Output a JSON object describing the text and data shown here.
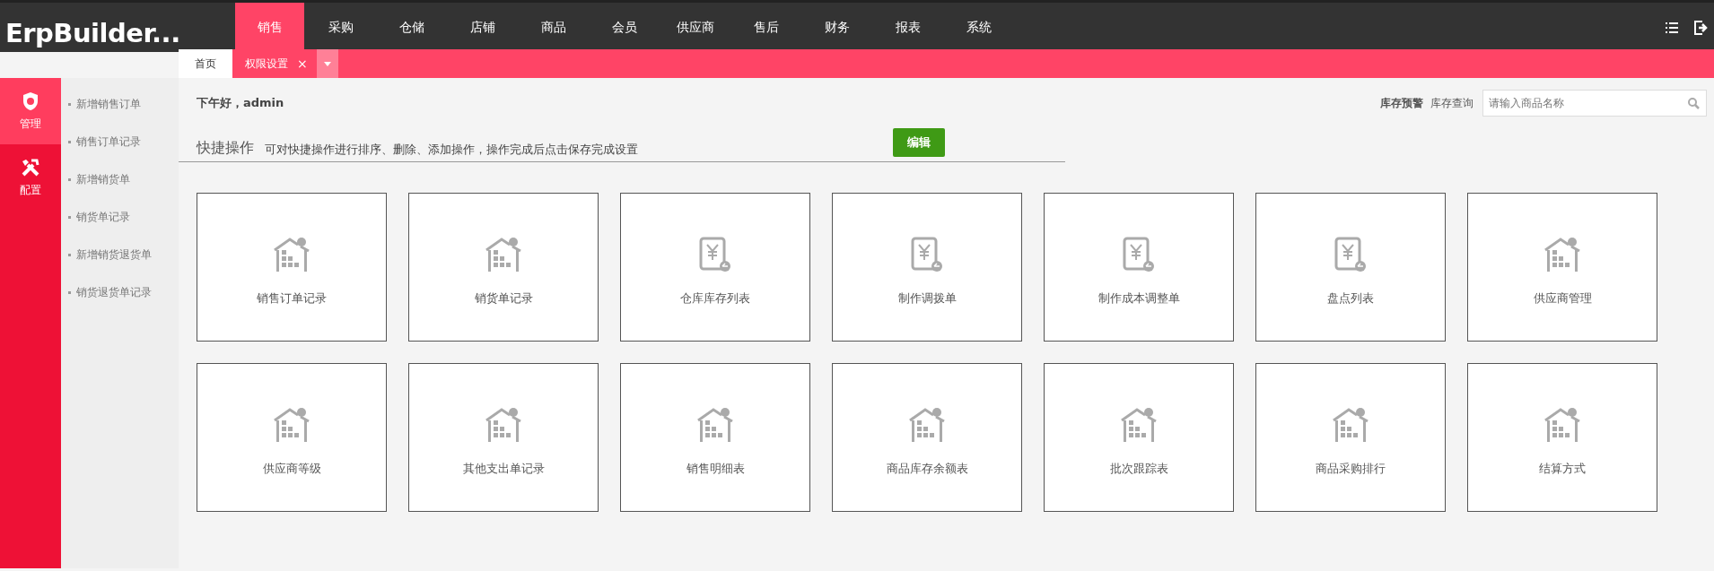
{
  "logo": "ErpBuilder...",
  "nav": [
    {
      "label": "销售",
      "selected": true
    },
    {
      "label": "采购",
      "selected": false
    },
    {
      "label": "仓储",
      "selected": false
    },
    {
      "label": "店铺",
      "selected": false
    },
    {
      "label": "商品",
      "selected": false
    },
    {
      "label": "会员",
      "selected": false
    },
    {
      "label": "供应商",
      "selected": false
    },
    {
      "label": "售后",
      "selected": false
    },
    {
      "label": "财务",
      "selected": false
    },
    {
      "label": "报表",
      "selected": false
    },
    {
      "label": "系统",
      "selected": false
    }
  ],
  "tabs": [
    {
      "label": "首页",
      "selected": false,
      "closable": false
    },
    {
      "label": "权限设置",
      "selected": true,
      "closable": true,
      "close": "×"
    }
  ],
  "modules": [
    {
      "label": "管理",
      "kind": "shield",
      "selected": true
    },
    {
      "label": "配置",
      "kind": "tools",
      "selected": false
    }
  ],
  "submenu": [
    "新增销售订单",
    "销售订单记录",
    "新增销货单",
    "销货单记录",
    "新增销货退货单",
    "销货退货单记录"
  ],
  "greeting": "下午好，admin",
  "links": [
    "库存预警",
    "库存查询"
  ],
  "search": {
    "placeholder": "请输入商品名称"
  },
  "quick": {
    "title": "快捷操作",
    "hint": "可对快捷操作进行排序、删除、添加操作，操作完成后点击保存完成设置",
    "button": "编辑"
  },
  "tiles": [
    {
      "label": "销售订单记录",
      "kind": "house"
    },
    {
      "label": "销货单记录",
      "kind": "house"
    },
    {
      "label": "仓库库存列表",
      "kind": "yen"
    },
    {
      "label": "制作调拨单",
      "kind": "yen"
    },
    {
      "label": "制作成本调整单",
      "kind": "yen"
    },
    {
      "label": "盘点列表",
      "kind": "yen"
    },
    {
      "label": "供应商管理",
      "kind": "house"
    },
    {
      "label": "供应商等级",
      "kind": "house"
    },
    {
      "label": "其他支出单记录",
      "kind": "house"
    },
    {
      "label": "销售明细表",
      "kind": "house"
    },
    {
      "label": "商品库存余额表",
      "kind": "house"
    },
    {
      "label": "批次跟踪表",
      "kind": "house"
    },
    {
      "label": "商品采购排行",
      "kind": "house"
    },
    {
      "label": "结算方式",
      "kind": "house"
    }
  ]
}
